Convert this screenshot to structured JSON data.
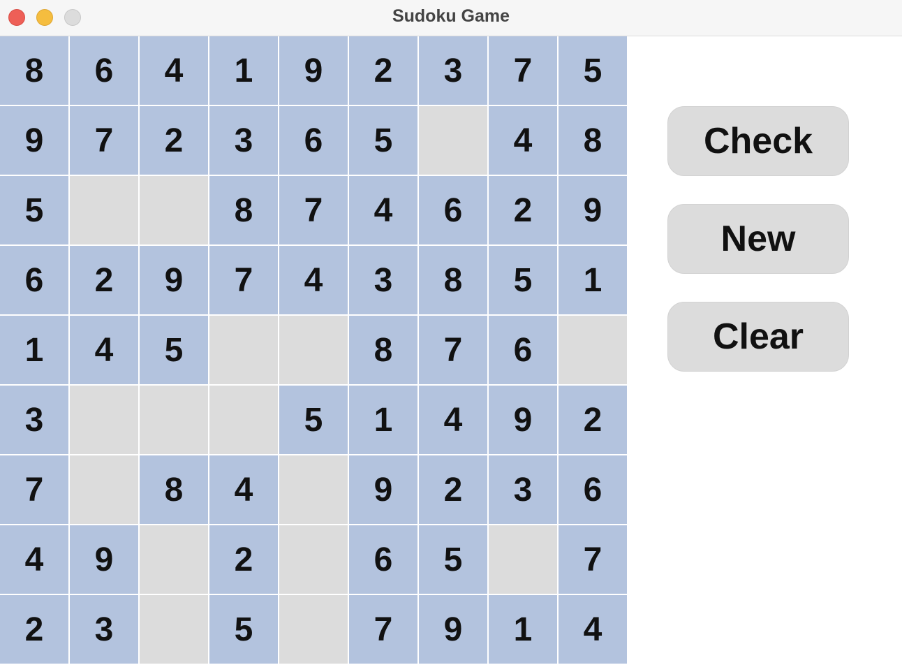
{
  "window": {
    "title": "Sudoku Game",
    "traffic_colors": {
      "close": "#ee5f57",
      "minimize": "#f5bd3f",
      "zoom": "#dcdcdc"
    }
  },
  "board": {
    "given_color": "#b3c3de",
    "empty_color": "#dcdcdc",
    "rows": [
      [
        "8",
        "6",
        "4",
        "1",
        "9",
        "2",
        "3",
        "7",
        "5"
      ],
      [
        "9",
        "7",
        "2",
        "3",
        "6",
        "5",
        "",
        "4",
        "8"
      ],
      [
        "5",
        "",
        "",
        "8",
        "7",
        "4",
        "6",
        "2",
        "9"
      ],
      [
        "6",
        "2",
        "9",
        "7",
        "4",
        "3",
        "8",
        "5",
        "1"
      ],
      [
        "1",
        "4",
        "5",
        "",
        "",
        "8",
        "7",
        "6",
        ""
      ],
      [
        "3",
        "",
        "",
        "",
        "5",
        "1",
        "4",
        "9",
        "2"
      ],
      [
        "7",
        "",
        "8",
        "4",
        "",
        "9",
        "2",
        "3",
        "6"
      ],
      [
        "4",
        "9",
        "",
        "2",
        "",
        "6",
        "5",
        "",
        "7"
      ],
      [
        "2",
        "3",
        "",
        "5",
        "",
        "7",
        "9",
        "1",
        "4"
      ]
    ]
  },
  "controls": {
    "check_label": "Check",
    "new_label": "New",
    "clear_label": "Clear"
  }
}
